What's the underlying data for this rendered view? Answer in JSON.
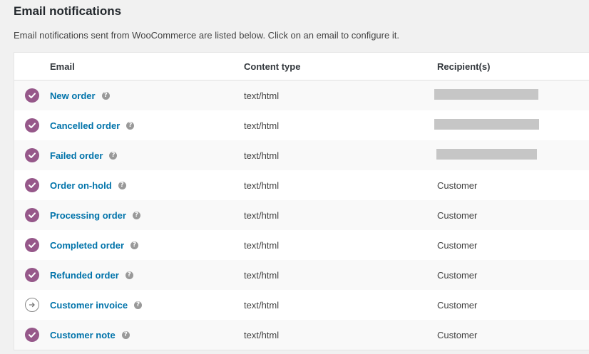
{
  "page": {
    "title": "Email notifications",
    "description": "Email notifications sent from WooCommerce are listed below. Click on an email to configure it."
  },
  "table": {
    "headers": {
      "email": "Email",
      "content_type": "Content type",
      "recipients": "Recipient(s)"
    },
    "rows": [
      {
        "status": "enabled",
        "status_icon": "check-circle-icon",
        "email": "New order",
        "content_type": "text/html",
        "recipient": "",
        "recipient_redacted": true
      },
      {
        "status": "enabled",
        "status_icon": "check-circle-icon",
        "email": "Cancelled order",
        "content_type": "text/html",
        "recipient": "",
        "recipient_redacted": true
      },
      {
        "status": "enabled",
        "status_icon": "check-circle-icon",
        "email": "Failed order",
        "content_type": "text/html",
        "recipient": "",
        "recipient_redacted": true
      },
      {
        "status": "enabled",
        "status_icon": "check-circle-icon",
        "email": "Order on-hold",
        "content_type": "text/html",
        "recipient": "Customer",
        "recipient_redacted": false
      },
      {
        "status": "enabled",
        "status_icon": "check-circle-icon",
        "email": "Processing order",
        "content_type": "text/html",
        "recipient": "Customer",
        "recipient_redacted": false
      },
      {
        "status": "enabled",
        "status_icon": "check-circle-icon",
        "email": "Completed order",
        "content_type": "text/html",
        "recipient": "Customer",
        "recipient_redacted": false
      },
      {
        "status": "enabled",
        "status_icon": "check-circle-icon",
        "email": "Refunded order",
        "content_type": "text/html",
        "recipient": "Customer",
        "recipient_redacted": false
      },
      {
        "status": "manual",
        "status_icon": "arrow-right-circle-icon",
        "email": "Customer invoice",
        "content_type": "text/html",
        "recipient": "Customer",
        "recipient_redacted": false
      },
      {
        "status": "enabled",
        "status_icon": "check-circle-icon",
        "email": "Customer note",
        "content_type": "text/html",
        "recipient": "Customer",
        "recipient_redacted": false
      }
    ]
  },
  "icons": {
    "help": "?"
  },
  "colors": {
    "link": "#0073aa",
    "enabled_status": "#96588a",
    "page_background": "#f1f1f1",
    "redaction": "#c6c6c6"
  }
}
